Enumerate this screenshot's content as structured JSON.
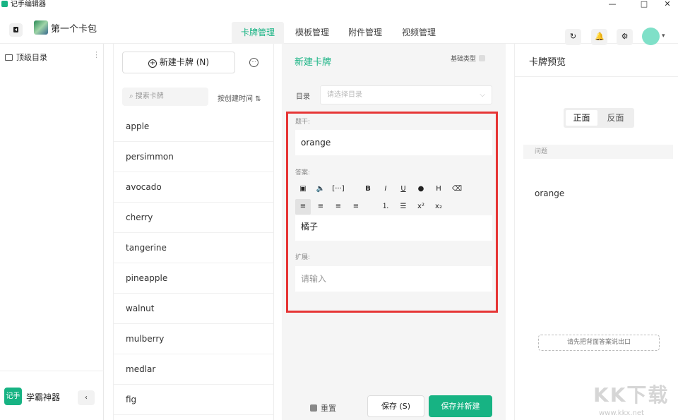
{
  "window": {
    "title": "记手编辑器",
    "minimize": "—",
    "maximize": "□",
    "close": "✕"
  },
  "header": {
    "deck_name": "第一个卡包",
    "tabs": [
      {
        "label": "卡牌管理",
        "active": true
      },
      {
        "label": "模板管理",
        "active": false
      },
      {
        "label": "附件管理",
        "active": false
      },
      {
        "label": "视频管理",
        "active": false
      }
    ],
    "icons": {
      "refresh": "↻",
      "bell": "🔔",
      "settings": "⚙"
    },
    "avatar_dropdown": "▾"
  },
  "sidebar": {
    "root_dir": "顶级目录",
    "more": "⋮",
    "brand_logo": "记手",
    "brand_name": "学霸神器",
    "collapse": "‹"
  },
  "card_panel": {
    "new_card_label": "新建卡牌 (N)",
    "more": "···",
    "search_placeholder": "搜索卡牌",
    "sort_label": "按创建时间",
    "sort_icon": "⇅",
    "cards": [
      "apple",
      "persimmon",
      "avocado",
      "cherry",
      "tangerine",
      "pineapple",
      "walnut",
      "mulberry",
      "medlar",
      "fig"
    ]
  },
  "editor": {
    "title": "新建卡牌",
    "basic_type": "基础类型",
    "dir_label": "目录",
    "dir_placeholder": "请选择目录",
    "stem_label": "题干:",
    "stem_value": "orange",
    "answer_label": "答案:",
    "answer_value": "橘子",
    "ext_label": "扩展:",
    "ext_placeholder": "请输入",
    "toolbar_row1": [
      "▣",
      "🔈",
      "[···]",
      "B",
      "I",
      "U",
      "●",
      "H",
      "⌫"
    ],
    "toolbar_row2": [
      "≡",
      "≡",
      "≡",
      "≡",
      "⒈",
      "☰",
      "x²",
      "x₂"
    ],
    "reset_label": "重置",
    "save_label": "保存 (S)",
    "save_new_label": "保存并新建"
  },
  "preview": {
    "title": "卡牌预览",
    "front": "正面",
    "back": "反面",
    "question_label": "问题",
    "question_text": "orange",
    "hint": "请先把背面答案说出口"
  },
  "watermark": {
    "text": "KK下载",
    "url": "www.kkx.net"
  },
  "colors": {
    "accent": "#17b383",
    "highlight": "#e63535"
  }
}
